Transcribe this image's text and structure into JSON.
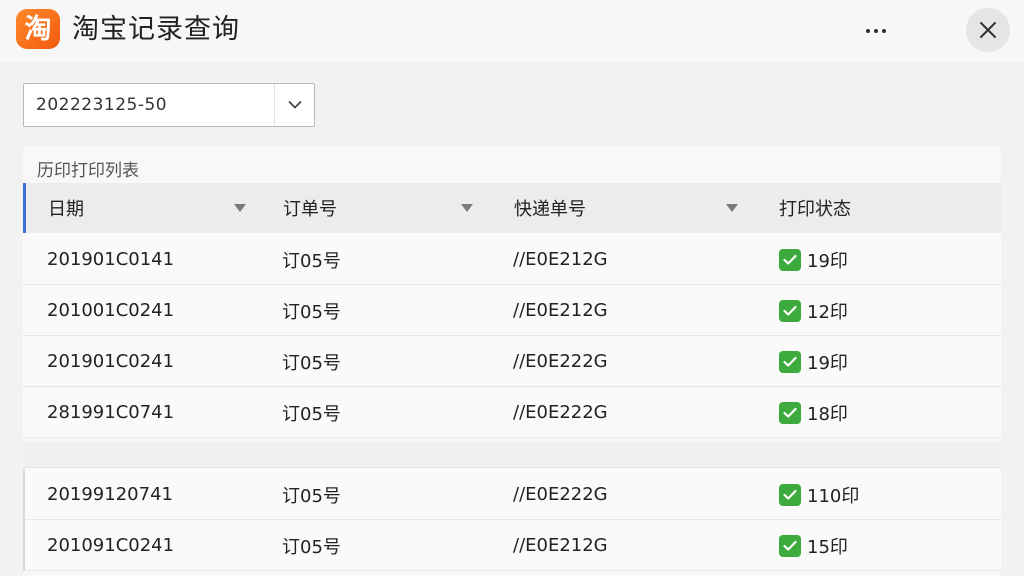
{
  "window": {
    "logo_char": "淘",
    "title": "淘宝记录查询",
    "accent_color": "#f5701c",
    "more_icon": "more-horizontal-icon",
    "close_icon": "close-icon"
  },
  "filter": {
    "date_value": "202223125-50",
    "dropdown_icon": "chevron-down-icon"
  },
  "table": {
    "section_label": "历印打印列表",
    "columns": [
      {
        "label": "日期"
      },
      {
        "label": "订单号"
      },
      {
        "label": "快递单号"
      },
      {
        "label": "打印状态"
      }
    ],
    "rows": [
      {
        "date": "201901C0141",
        "order": "订05号",
        "tracking": "//E0E212G",
        "status": "19印"
      },
      {
        "date": "201001C0241",
        "order": "订05号",
        "tracking": "//E0E212G",
        "status": "12印"
      },
      {
        "date": "201901C0241",
        "order": "订05号",
        "tracking": "//E0E222G",
        "status": "19印"
      },
      {
        "date": "281991C0741",
        "order": "订05号",
        "tracking": "//E0E222G",
        "status": "18印"
      },
      {
        "date": "20199120741",
        "order": "订05号",
        "tracking": "//E0E222G",
        "status": "110印"
      },
      {
        "date": "201091C0241",
        "order": "订05号",
        "tracking": "//E0E212G",
        "status": "15印"
      }
    ],
    "status_color": "#3daa3d",
    "header_accent": "#3b6fd1"
  }
}
